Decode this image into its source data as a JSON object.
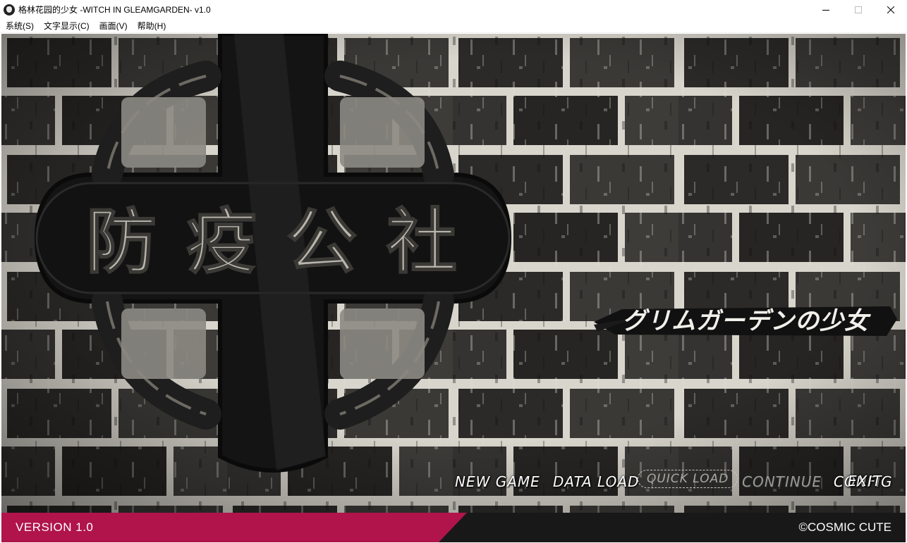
{
  "window": {
    "title": "格林花园的少女 -WITCH IN GLEAMGARDEN- v1.0",
    "icon": "app-icon"
  },
  "menubar": {
    "items": [
      {
        "label": "系统(S)"
      },
      {
        "label": "文字显示(C)"
      },
      {
        "label": "画面(V)"
      },
      {
        "label": "帮助(H)"
      }
    ]
  },
  "logo": {
    "kanji": [
      "防",
      "疫",
      "公",
      "社"
    ]
  },
  "subtitle": "グリムガーデンの少女",
  "game_menu": {
    "new_game": "NEW GAME",
    "data_load": "DATA LOAD",
    "quick_load": "QUICK LOAD",
    "continue": "CONTINUE",
    "config": "CONFIG",
    "exit": "EXIT"
  },
  "footer": {
    "version": "VERSION 1.0",
    "copyright": "©COSMIC CUTE"
  },
  "colors": {
    "version_strip": "#b0144a",
    "footer_bg": "#181818",
    "button_text": "#ffffff",
    "button_disabled": "#9a9a94"
  }
}
